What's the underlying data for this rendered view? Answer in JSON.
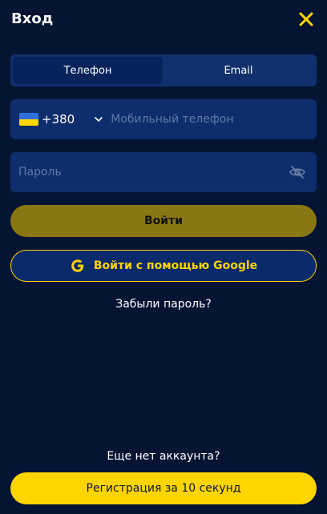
{
  "header": {
    "title": "Вход",
    "close_icon": "close-icon"
  },
  "tabs": [
    {
      "label": "Телефон",
      "active": true
    },
    {
      "label": "Email",
      "active": false
    }
  ],
  "phone": {
    "country_code": "+380",
    "flag": "ukraine-flag-icon",
    "placeholder": "Мобильный телефон",
    "value": ""
  },
  "password": {
    "placeholder": "Пароль",
    "value": "",
    "toggle_icon": "eye-off-icon"
  },
  "login_button": "Войти",
  "google_button": "Войти с помощью Google",
  "forgot_link": "Забыли пароль?",
  "no_account_text": "Еще нет аккаунта?",
  "register_button": "Регистрация за 10 секунд",
  "colors": {
    "background": "#061433",
    "field": "#0e2d6c",
    "accent": "#ffd500",
    "login_button": "#8b7614"
  }
}
